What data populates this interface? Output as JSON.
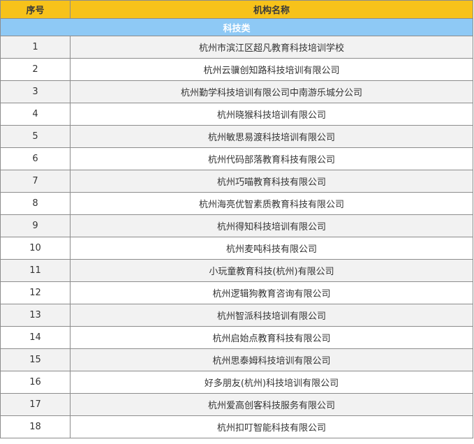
{
  "table": {
    "header": {
      "no": "序号",
      "name": "机构名称"
    },
    "category": "科技类",
    "rows": [
      {
        "no": "1",
        "name": "杭州市滨江区超凡教育科技培训学校"
      },
      {
        "no": "2",
        "name": "杭州云骥创知路科技培训有限公司"
      },
      {
        "no": "3",
        "name": "杭州勤学科技培训有限公司中南游乐城分公司"
      },
      {
        "no": "4",
        "name": "杭州晓猴科技培训有限公司"
      },
      {
        "no": "5",
        "name": "杭州敏思易渡科技培训有限公司"
      },
      {
        "no": "6",
        "name": "杭州代码部落教育科技有限公司"
      },
      {
        "no": "7",
        "name": "杭州巧喵教育科技有限公司"
      },
      {
        "no": "8",
        "name": "杭州海亮优智素质教育科技有限公司"
      },
      {
        "no": "9",
        "name": "杭州得知科技培训有限公司"
      },
      {
        "no": "10",
        "name": "杭州麦吨科技有限公司"
      },
      {
        "no": "11",
        "name": "小玩童教育科技(杭州)有限公司"
      },
      {
        "no": "12",
        "name": "杭州逻辑狗教育咨询有限公司"
      },
      {
        "no": "13",
        "name": "杭州智派科技培训有限公司"
      },
      {
        "no": "14",
        "name": "杭州启始点教育科技有限公司"
      },
      {
        "no": "15",
        "name": "杭州思泰姆科技培训有限公司"
      },
      {
        "no": "16",
        "name": "好多朋友(杭州)科技培训有限公司"
      },
      {
        "no": "17",
        "name": "杭州爱高创客科技服务有限公司"
      },
      {
        "no": "18",
        "name": "杭州扣叮智能科技有限公司"
      }
    ]
  }
}
